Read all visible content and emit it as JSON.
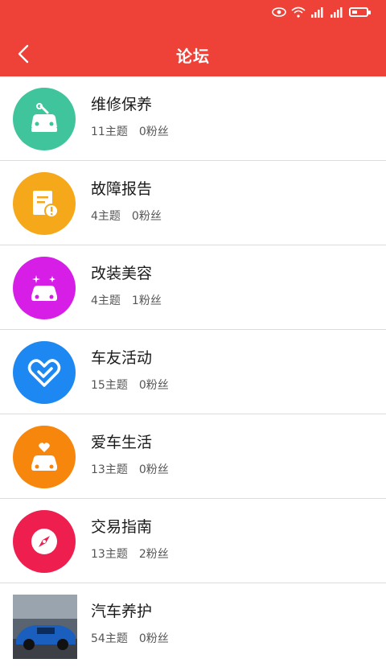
{
  "header": {
    "title": "论坛",
    "accent": "#ee4137"
  },
  "status_bar": {
    "battery_percent": 40
  },
  "forums": [
    {
      "name": "维修保养",
      "topics": "11主题",
      "fans": "0粉丝",
      "color": "#3fc49c",
      "icon": "car-repair-icon"
    },
    {
      "name": "故障报告",
      "topics": "4主题",
      "fans": "0粉丝",
      "color": "#f5a81a",
      "icon": "report-icon"
    },
    {
      "name": "改装美容",
      "topics": "4主题",
      "fans": "1粉丝",
      "color": "#d61ee6",
      "icon": "sparkle-car-icon"
    },
    {
      "name": "车友活动",
      "topics": "15主题",
      "fans": "0粉丝",
      "color": "#1e88f2",
      "icon": "heart-hands-icon"
    },
    {
      "name": "爱车生活",
      "topics": "13主题",
      "fans": "0粉丝",
      "color": "#f7860c",
      "icon": "car-heart-icon"
    },
    {
      "name": "交易指南",
      "topics": "13主题",
      "fans": "2粉丝",
      "color": "#ee1f4e",
      "icon": "compass-icon"
    },
    {
      "name": "汽车养护",
      "topics": "54主题",
      "fans": "0粉丝",
      "color": "#1b5fbe",
      "icon": "car-photo"
    }
  ]
}
